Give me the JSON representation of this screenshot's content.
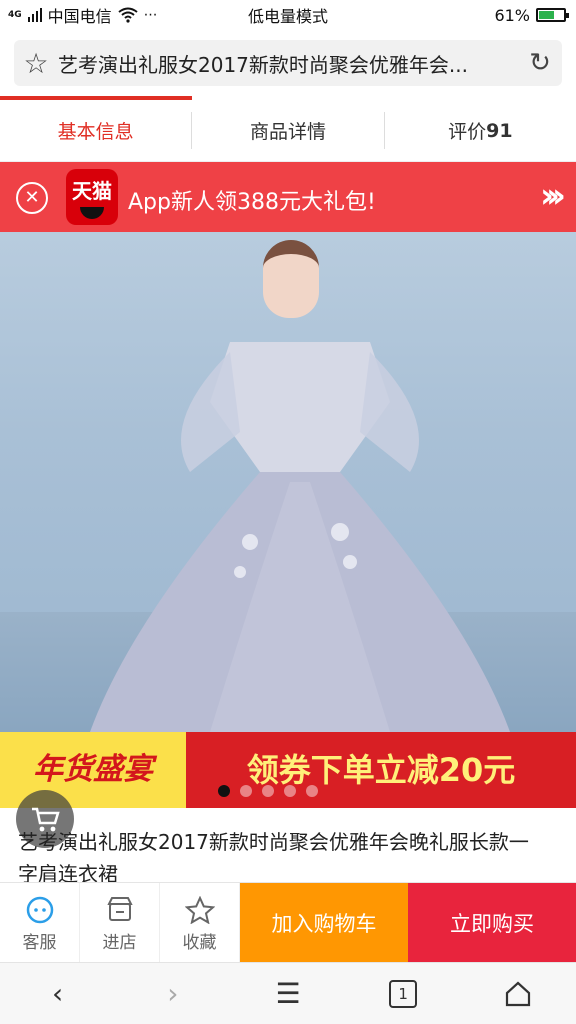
{
  "status_bar": {
    "network": "4G",
    "carrier": "中国电信",
    "mode": "低电量模式",
    "battery": "61%",
    "battery_level": 0.61,
    "battery_color": "#2bb24c"
  },
  "url_bar": {
    "title": "艺考演出礼服女2017新款时尚聚会优雅年会...",
    "star_icon": "star-icon",
    "reload_icon": "reload-icon"
  },
  "tabs": [
    {
      "label": "基本信息",
      "active": true
    },
    {
      "label": "商品详情",
      "active": false
    },
    {
      "label": "评价",
      "count": "91",
      "active": false
    }
  ],
  "promo": {
    "logo_text": "天猫",
    "text": "App新人领388元大礼包!",
    "color": "#ef4146"
  },
  "festival_banner": {
    "left": "年货盛宴",
    "right": "领券下单立减20元"
  },
  "carousel": {
    "count": 5,
    "active_index": 0
  },
  "product": {
    "title": "艺考演出礼服女2017新款时尚聚会优雅年会晚礼服长款一字肩连衣裙"
  },
  "actions": {
    "service": "客服",
    "shop": "进店",
    "favorite": "收藏",
    "add_to_cart": "加入购物车",
    "buy_now": "立即购买",
    "cart_color": "#ff9702",
    "buy_color": "#e8243d"
  },
  "browser_nav": {
    "tab_count": "1"
  }
}
